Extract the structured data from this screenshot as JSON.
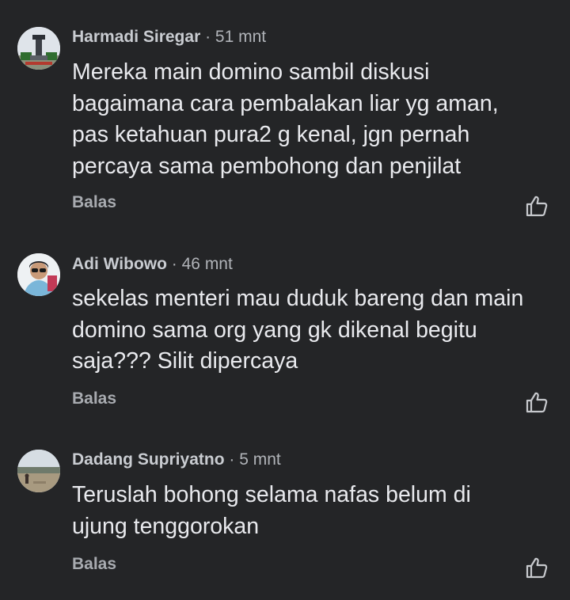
{
  "comments": [
    {
      "author": "Harmadi Siregar",
      "separator": " · ",
      "time": "51 mnt",
      "text": "Mereka main domino sambil diskusi\nbagaimana cara pembalakan liar yg aman,\npas ketahuan pura2 g kenal, jgn pernah\npercaya sama pembohong dan penjilat",
      "reply_label": "Balas",
      "avatar_icon": "monument-photo-icon",
      "like_icon": "thumbs-up-outline-icon"
    },
    {
      "author": "Adi Wibowo",
      "separator": " · ",
      "time": "46 mnt",
      "text": "sekelas menteri mau duduk bareng dan main\ndomino sama org yang gk dikenal begitu\nsaja??? Silit dipercaya",
      "reply_label": "Balas",
      "avatar_icon": "person-selfie-photo-icon",
      "like_icon": "thumbs-up-outline-icon"
    },
    {
      "author": "Dadang Supriyatno",
      "separator": " · ",
      "time": "5 mnt",
      "text": "Teruslah bohong selama nafas belum di\nujung tenggorokan",
      "reply_label": "Balas",
      "avatar_icon": "landscape-photo-icon",
      "like_icon": "thumbs-up-outline-icon"
    }
  ],
  "colors": {
    "background": "#242527",
    "text_primary": "#e9eaee",
    "text_secondary": "#b0b3b8"
  }
}
